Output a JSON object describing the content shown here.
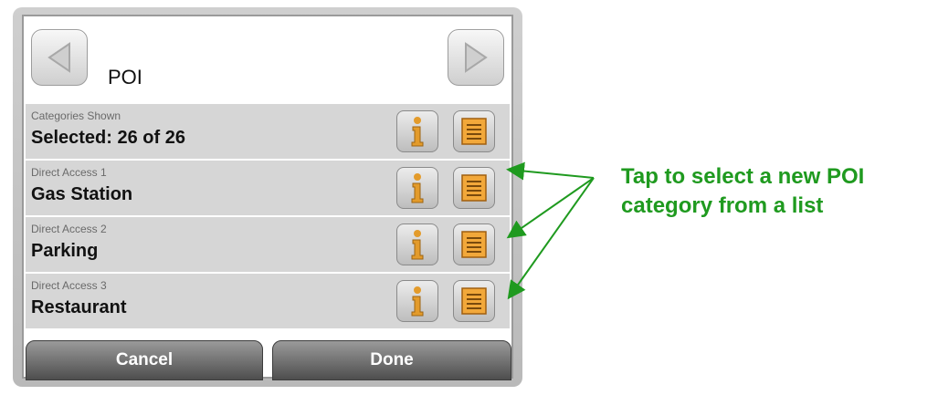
{
  "header": {
    "title": "POI"
  },
  "rows": [
    {
      "caption": "Categories Shown",
      "value": "Selected: 26 of 26"
    },
    {
      "caption": "Direct Access 1",
      "value": "Gas Station"
    },
    {
      "caption": "Direct Access 2",
      "value": "Parking"
    },
    {
      "caption": "Direct Access 3",
      "value": "Restaurant"
    }
  ],
  "buttons": {
    "cancel": "Cancel",
    "done": "Done"
  },
  "annotation": {
    "line1": "Tap to select a new POI",
    "line2": "category from a list"
  },
  "colors": {
    "annotation": "#1f9a1f",
    "list_icon": "#f2a83a",
    "info_icon": "#e39b2b"
  }
}
